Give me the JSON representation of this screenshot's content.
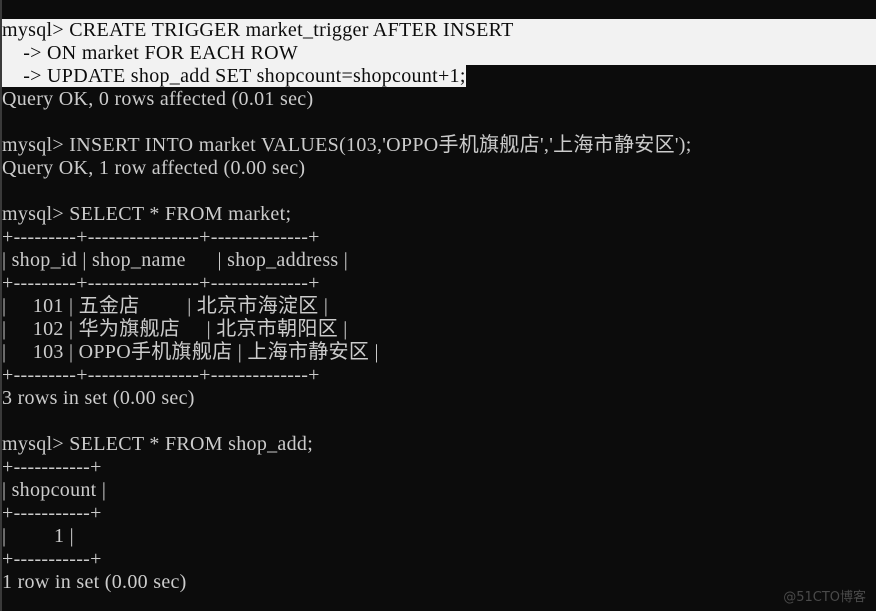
{
  "terminal": {
    "block1": {
      "line1": "mysql> CREATE TRIGGER market_trigger AFTER INSERT",
      "line2": "    -> ON market FOR EACH ROW",
      "line3": "    -> UPDATE shop_add SET shopcount=shopcount+1;",
      "result": "Query OK, 0 rows affected (0.01 sec)"
    },
    "block2": {
      "command": "mysql> INSERT INTO market VALUES(103,'OPPO手机旗舰店','上海市静安区');",
      "result": "Query OK, 1 row affected (0.00 sec)"
    },
    "block3": {
      "command": "mysql> SELECT * FROM market;",
      "border": "+---------+----------------+--------------+",
      "header": "| shop_id | shop_name      | shop_address |",
      "columns": [
        "shop_id",
        "shop_name",
        "shop_address"
      ],
      "rows": [
        {
          "text": "|     101 | 五金店         | 北京市海淀区 |",
          "shop_id": "101",
          "shop_name": "五金店",
          "shop_address": "北京市海淀区"
        },
        {
          "text": "|     102 | 华为旗舰店     | 北京市朝阳区 |",
          "shop_id": "102",
          "shop_name": "华为旗舰店",
          "shop_address": "北京市朝阳区"
        },
        {
          "text": "|     103 | OPPO手机旗舰店 | 上海市静安区 |",
          "shop_id": "103",
          "shop_name": "OPPO手机旗舰店",
          "shop_address": "上海市静安区"
        }
      ],
      "result": "3 rows in set (0.00 sec)"
    },
    "block4": {
      "command": "mysql> SELECT * FROM shop_add;",
      "border": "+-----------+",
      "header": "| shopcount |",
      "columns": [
        "shopcount"
      ],
      "rows": [
        {
          "text": "|         1 |",
          "shopcount": "1"
        }
      ],
      "result": "1 row in set (0.00 sec)"
    }
  },
  "watermark": "@51CTO博客",
  "colors": {
    "background": "#0c0c0c",
    "foreground": "#cccccc",
    "selection": "#f2f2f2"
  }
}
